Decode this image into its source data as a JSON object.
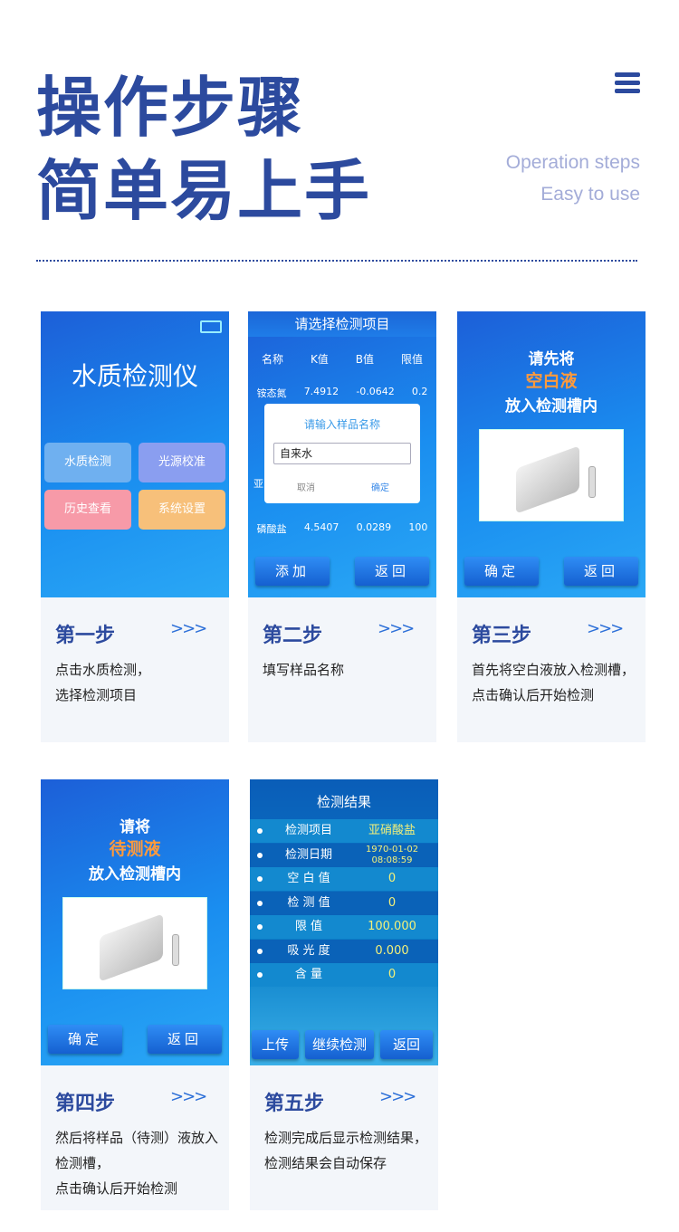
{
  "header": {
    "title1": "操作步骤",
    "title2": "简单易上手",
    "en1": "Operation steps",
    "en2": "Easy to use",
    "menu_icon": "list-icon"
  },
  "steps": [
    {
      "label": "第一步",
      "arrow": ">>>",
      "desc": "点击水质检测，\n选择检测项目"
    },
    {
      "label": "第二步",
      "arrow": ">>>",
      "desc": "填写样品名称"
    },
    {
      "label": "第三步",
      "arrow": ">>>",
      "desc": "首先将空白液放入检测槽，点击确认后开始检测"
    },
    {
      "label": "第四步",
      "arrow": ">>>",
      "desc": "然后将样品（待测）液放入检测槽，\n点击确认后开始检测"
    },
    {
      "label": "第五步",
      "arrow": ">>>",
      "desc": "检测完成后显示检测结果，检测结果会自动保存"
    }
  ],
  "screen1": {
    "title": "水质检测仪",
    "tiles": [
      "水质检测",
      "光源校准",
      "历史查看",
      "系统设置"
    ]
  },
  "screen2": {
    "title": "请选择检测项目",
    "headers": [
      "名称",
      "K值",
      "B值",
      "限值"
    ],
    "rows": [
      [
        "铵态氮",
        "7.4912",
        "-0.0642",
        "0.2"
      ],
      [
        "磷酸盐",
        "4.5407",
        "0.0289",
        "100"
      ]
    ],
    "hidden_prefix": "亚",
    "dialog": {
      "title": "请输入样品名称",
      "value": "自来水",
      "cancel": "取消",
      "ok": "确定"
    },
    "add": "添加",
    "back": "返回"
  },
  "screen3": {
    "line1": "请先将",
    "line2": "空白液",
    "line3": "放入检测槽内",
    "ok": "确定",
    "back": "返回"
  },
  "screen4": {
    "line1": "请将",
    "line2": "待测液",
    "line3": "放入检测槽内",
    "ok": "确定",
    "back": "返回"
  },
  "screen5": {
    "title": "检测结果",
    "rows": [
      [
        "检测项目",
        "亚硝酸盐"
      ],
      [
        "检测日期",
        "1970-01-02 08:08:59"
      ],
      [
        "空 白 值",
        "0"
      ],
      [
        "检 测 值",
        "0"
      ],
      [
        "限 值",
        "100.000"
      ],
      [
        "吸 光 度",
        "0.000"
      ],
      [
        "含 量",
        "0"
      ]
    ],
    "upload": "上传",
    "continue": "继续检测",
    "back": "返回"
  },
  "colors": {
    "title": "#2c4a9e",
    "accent": "#1a8ef0",
    "highlight": "#ff9a3c"
  }
}
